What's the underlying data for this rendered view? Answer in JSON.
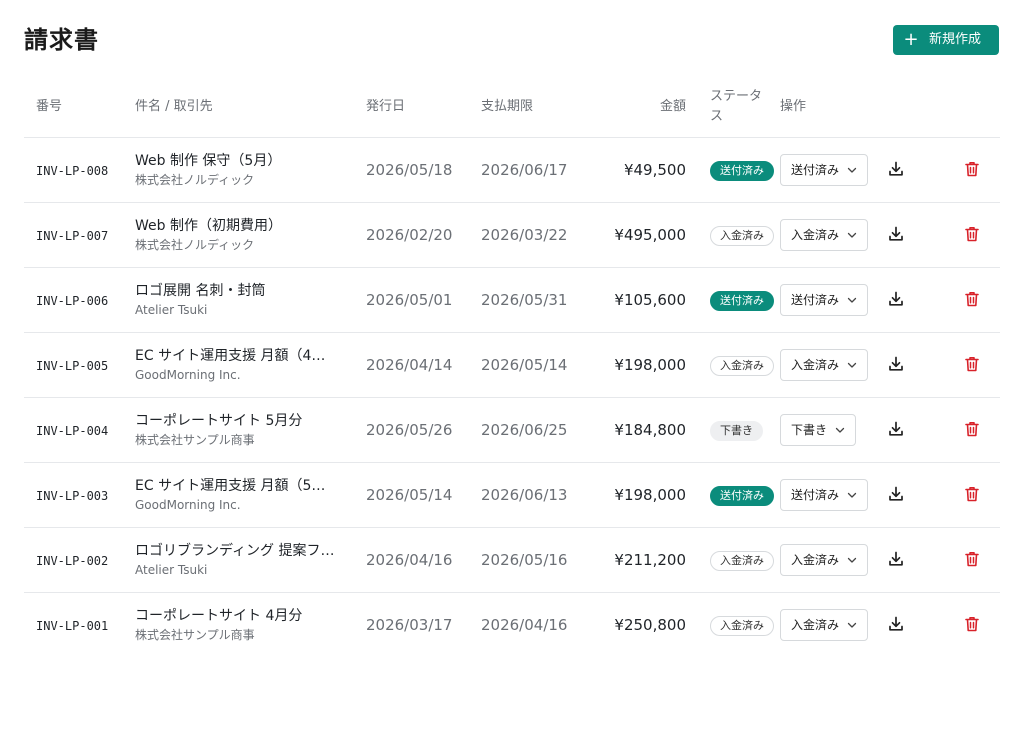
{
  "header": {
    "title": "請求書",
    "new_button_label": "新規作成",
    "new_button_icon": "plus-icon"
  },
  "colors": {
    "accent": "#0b8c7c",
    "danger": "#d8222a"
  },
  "table": {
    "columns": {
      "number": "番号",
      "title": "件名 / 取引先",
      "issue_date": "発行日",
      "due_date": "支払期限",
      "amount": "金額",
      "status_line1": "ステータ",
      "status_line2": "ス",
      "operations": "操作"
    },
    "rows": [
      {
        "number": "INV-LP-008",
        "title": "Web 制作 保守（5月）",
        "client": "株式会社ノルディック",
        "issue_date": "2026/05/18",
        "due_date": "2026/06/17",
        "amount": "¥49,500",
        "status": "送付済み",
        "status_kind": "sent",
        "select_value": "送付済み"
      },
      {
        "number": "INV-LP-007",
        "title": "Web 制作（初期費用）",
        "client": "株式会社ノルディック",
        "issue_date": "2026/02/20",
        "due_date": "2026/03/22",
        "amount": "¥495,000",
        "status": "入金済み",
        "status_kind": "paid",
        "select_value": "入金済み"
      },
      {
        "number": "INV-LP-006",
        "title": "ロゴ展開 名刺・封筒",
        "client": "Atelier Tsuki",
        "issue_date": "2026/05/01",
        "due_date": "2026/05/31",
        "amount": "¥105,600",
        "status": "送付済み",
        "status_kind": "sent",
        "select_value": "送付済み"
      },
      {
        "number": "INV-LP-005",
        "title": "EC サイト運用支援 月額（4…",
        "client": "GoodMorning Inc.",
        "issue_date": "2026/04/14",
        "due_date": "2026/05/14",
        "amount": "¥198,000",
        "status": "入金済み",
        "status_kind": "paid",
        "select_value": "入金済み"
      },
      {
        "number": "INV-LP-004",
        "title": "コーポレートサイト 5月分",
        "client": "株式会社サンプル商事",
        "issue_date": "2026/05/26",
        "due_date": "2026/06/25",
        "amount": "¥184,800",
        "status": "下書き",
        "status_kind": "draft",
        "select_value": "下書き"
      },
      {
        "number": "INV-LP-003",
        "title": "EC サイト運用支援 月額（5…",
        "client": "GoodMorning Inc.",
        "issue_date": "2026/05/14",
        "due_date": "2026/06/13",
        "amount": "¥198,000",
        "status": "送付済み",
        "status_kind": "sent",
        "select_value": "送付済み"
      },
      {
        "number": "INV-LP-002",
        "title": "ロゴリブランディング 提案フ…",
        "client": "Atelier Tsuki",
        "issue_date": "2026/04/16",
        "due_date": "2026/05/16",
        "amount": "¥211,200",
        "status": "入金済み",
        "status_kind": "paid",
        "select_value": "入金済み"
      },
      {
        "number": "INV-LP-001",
        "title": "コーポレートサイト 4月分",
        "client": "株式会社サンプル商事",
        "issue_date": "2026/03/17",
        "due_date": "2026/04/16",
        "amount": "¥250,800",
        "status": "入金済み",
        "status_kind": "paid",
        "select_value": "入金済み"
      }
    ]
  }
}
